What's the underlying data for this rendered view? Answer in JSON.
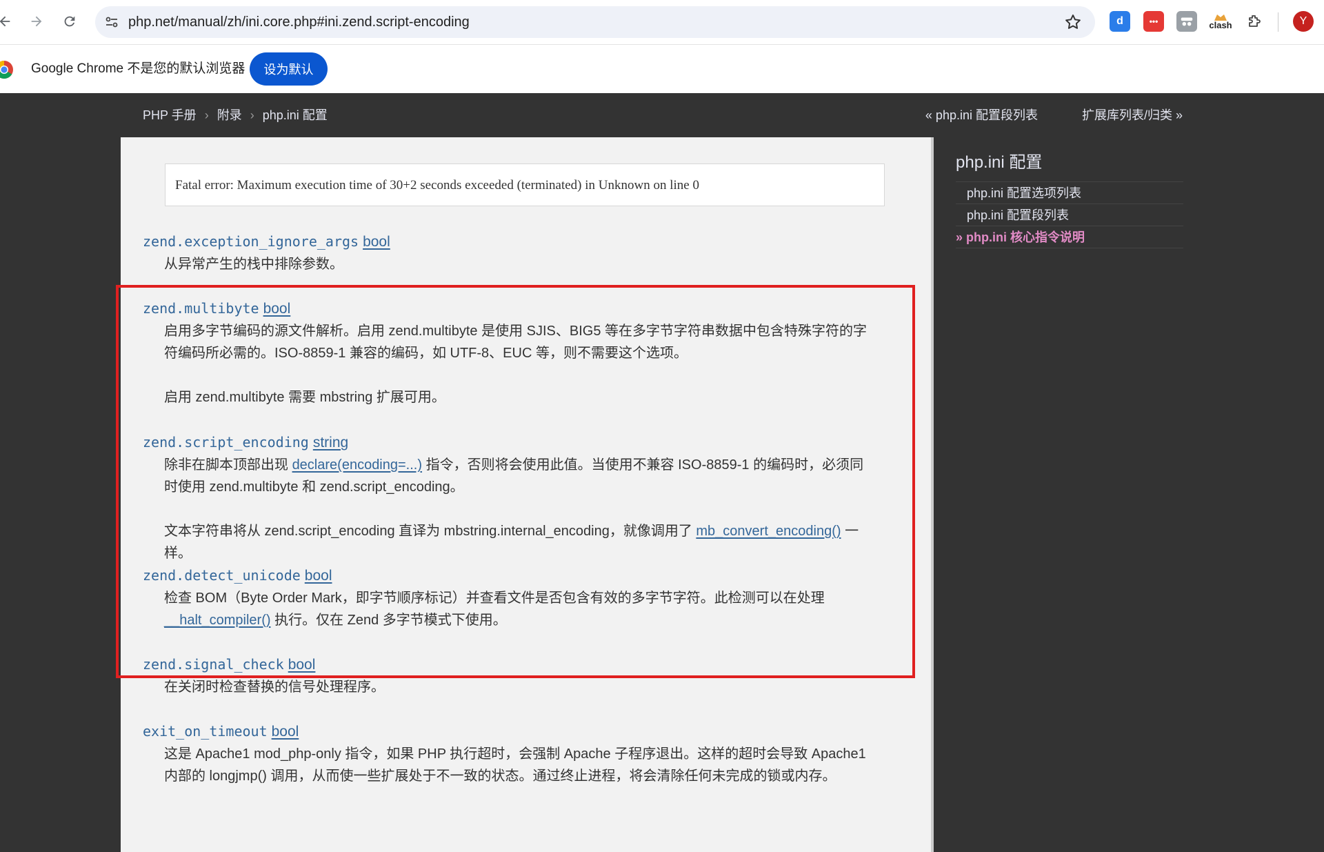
{
  "browser": {
    "url": "php.net/manual/zh/ini.core.php#ini.zend.script-encoding",
    "infobar_text": "Google Chrome 不是您的默认浏览器",
    "set_default_label": "设为默认",
    "extensions": [
      {
        "name": "dictionary-extension-icon",
        "glyph": "d",
        "color": "#2b7de9"
      },
      {
        "name": "dots-extension-icon",
        "glyph": "•••",
        "color": "#e53935"
      },
      {
        "name": "incognito-extension-icon",
        "glyph": "",
        "color": "#9aa0a6"
      },
      {
        "name": "clash-extension-icon",
        "glyph": "clash",
        "color": "#ffffff"
      }
    ],
    "profile_initial": "Y",
    "profile_color": "#c5221f"
  },
  "navbar": {
    "breadcrumb": [
      "PHP 手册",
      "附录",
      "php.ini 配置"
    ],
    "prev": "« php.ini 配置段列表",
    "next": "扩展库列表/归类 »"
  },
  "content": {
    "error_example": "Fatal error: Maximum execution time of 30+2 seconds exceeded (terminated) in Unknown on line 0",
    "directives": [
      {
        "name": "zend.exception_ignore_args",
        "type": "bool",
        "paragraphs": [
          "从异常产生的栈中排除参数。"
        ]
      },
      {
        "name": "zend.multibyte",
        "type": "bool",
        "paragraphs": [
          "启用多字节编码的源文件解析。启用 zend.multibyte 是使用 SJIS、BIG5 等在多字节字符串数据中包含特殊字符的字符编码所必需的。ISO-8859-1 兼容的编码，如 UTF-8、EUC 等，则不需要这个选项。",
          "启用 zend.multibyte 需要 mbstring 扩展可用。"
        ]
      },
      {
        "name": "zend.script_encoding",
        "type": "string",
        "p1_before": "除非在脚本顶部出现 ",
        "p1_link": "declare(encoding=...)",
        "p1_after": " 指令，否则将会使用此值。当使用不兼容 ISO-8859-1 的编码时，必须同时使用 zend.multibyte 和 zend.script_encoding。",
        "p2_before": "文本字符串将从 zend.script_encoding 直译为 mbstring.internal_encoding，就像调用了 ",
        "p2_link": "mb_convert_encoding()",
        "p2_after": " 一样。"
      },
      {
        "name": "zend.detect_unicode",
        "type": "bool",
        "p1_before": "检查 BOM（Byte Order Mark，即字节顺序标记）并查看文件是否包含有效的多字节字符。此检测可以在处理 ",
        "p1_link": "__halt_compiler()",
        "p1_after": " 执行。仅在 Zend 多字节模式下使用。"
      },
      {
        "name": "zend.signal_check",
        "type": "bool",
        "paragraphs": [
          "在关闭时检查替换的信号处理程序。"
        ]
      },
      {
        "name": "exit_on_timeout",
        "type": "bool",
        "paragraphs": [
          "这是 Apache1 mod_php-only 指令，如果 PHP 执行超时，会强制 Apache 子程序退出。这样的超时会导致 Apache1 内部的 longjmp() 调用，从而使一些扩展处于不一致的状态。通过终止进程，将会清除任何未完成的锁或内存。"
        ]
      }
    ]
  },
  "sidebar": {
    "title": "php.ini 配置",
    "items": [
      {
        "label": "php.ini 配置选项列表",
        "active": false
      },
      {
        "label": "php.ini 配置段列表",
        "active": false
      },
      {
        "label": "» php.ini 核心指令说明",
        "active": true
      }
    ]
  },
  "colors": {
    "link": "#336699",
    "active_sidebar": "#e28bc6",
    "highlight_box": "#e02020"
  }
}
